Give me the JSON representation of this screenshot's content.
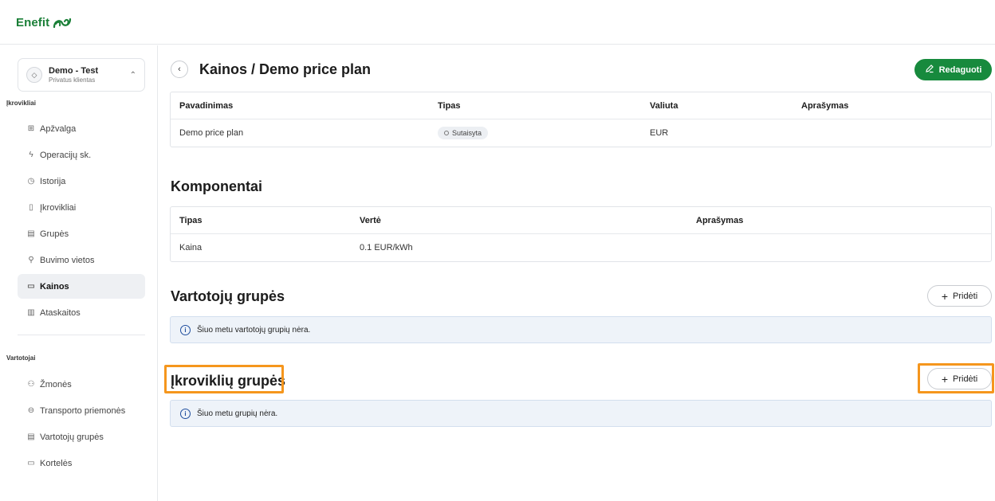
{
  "brand": {
    "name": "Enefit"
  },
  "account": {
    "name": "Demo - Test",
    "subtitle": "Privatus klientas"
  },
  "sidebar": {
    "section1_title": "Įkrovikliai",
    "section1_items": [
      {
        "label": "Apžvalga",
        "icon": "grid-icon"
      },
      {
        "label": "Operacijų sk.",
        "icon": "bolt-icon"
      },
      {
        "label": "Istorija",
        "icon": "clock-icon"
      },
      {
        "label": "Įkrovikliai",
        "icon": "charger-icon"
      },
      {
        "label": "Grupės",
        "icon": "group-icon"
      },
      {
        "label": "Buvimo vietos",
        "icon": "location-icon"
      },
      {
        "label": "Kainos",
        "icon": "price-tag-icon",
        "active": true
      },
      {
        "label": "Ataskaitos",
        "icon": "chart-icon"
      }
    ],
    "section2_title": "Vartotojai",
    "section2_items": [
      {
        "label": "Žmonės",
        "icon": "people-icon"
      },
      {
        "label": "Transporto priemonės",
        "icon": "car-icon"
      },
      {
        "label": "Vartotojų grupės",
        "icon": "group-icon"
      },
      {
        "label": "Kortelės",
        "icon": "card-icon"
      }
    ]
  },
  "header": {
    "title": "Kainos / Demo price plan",
    "edit_label": "Redaguoti"
  },
  "plan_table": {
    "columns": [
      "Pavadinimas",
      "Tipas",
      "Valiuta",
      "Aprašymas"
    ],
    "rows": [
      [
        "Demo price plan",
        "Sutaisyta",
        "EUR",
        ""
      ]
    ]
  },
  "components": {
    "title": "Komponentai",
    "columns": [
      "Tipas",
      "Vertė",
      "Aprašymas"
    ],
    "rows": [
      [
        "Kaina",
        "0.1 EUR/kWh",
        ""
      ]
    ]
  },
  "user_groups": {
    "title": "Vartotojų grupės",
    "add_label": "Pridėti",
    "empty_text": "Šiuo metu vartotojų grupių nėra."
  },
  "charger_groups": {
    "title": "Įkroviklių grupės",
    "add_label": "Pridėti",
    "empty_text": "Šiuo metu grupių nėra."
  },
  "colors": {
    "brand_green": "#178a3d",
    "highlight_orange": "#f5961d",
    "info_bg": "#eef3f9"
  }
}
